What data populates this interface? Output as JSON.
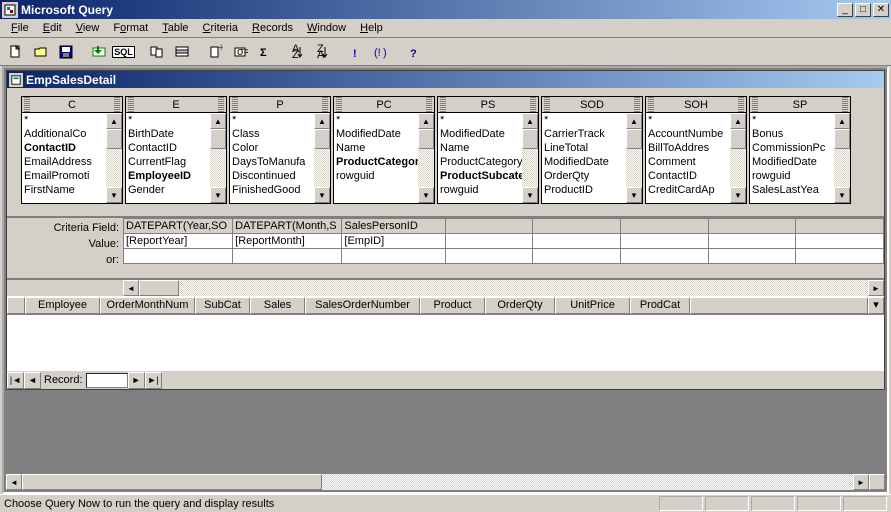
{
  "app": {
    "title": "Microsoft Query"
  },
  "menu": {
    "file": "File",
    "edit": "Edit",
    "view": "View",
    "format": "Format",
    "table": "Table",
    "criteria": "Criteria",
    "records": "Records",
    "window": "Window",
    "help": "Help"
  },
  "child": {
    "title": "EmpSalesDetail"
  },
  "tables": {
    "c": {
      "title": "C",
      "rows": [
        "*",
        "AdditionalCo",
        "ContactID",
        "EmailAddress",
        "EmailPromoti",
        "FirstName"
      ],
      "bold": [
        2
      ]
    },
    "e": {
      "title": "E",
      "rows": [
        "*",
        "BirthDate",
        "ContactID",
        "CurrentFlag",
        "EmployeeID",
        "Gender"
      ],
      "bold": [
        4
      ]
    },
    "p": {
      "title": "P",
      "rows": [
        "*",
        "Class",
        "Color",
        "DaysToManufa",
        "Discontinued",
        "FinishedGood"
      ],
      "bold": []
    },
    "pc": {
      "title": "PC",
      "rows": [
        "*",
        "ModifiedDate",
        "Name",
        "ProductCategory",
        "rowguid"
      ],
      "bold": [
        3
      ]
    },
    "ps": {
      "title": "PS",
      "rows": [
        "*",
        "ModifiedDate",
        "Name",
        "ProductCategory",
        "ProductSubcateg",
        "rowguid"
      ],
      "bold": [
        4
      ]
    },
    "sod": {
      "title": "SOD",
      "rows": [
        "*",
        "CarrierTrack",
        "LineTotal",
        "ModifiedDate",
        "OrderQty",
        "ProductID"
      ],
      "bold": []
    },
    "soh": {
      "title": "SOH",
      "rows": [
        "*",
        "AccountNumbe",
        "BillToAddres",
        "Comment",
        "ContactID",
        "CreditCardAp"
      ],
      "bold": []
    },
    "sp": {
      "title": "SP",
      "rows": [
        "*",
        "Bonus",
        "CommissionPc",
        "ModifiedDate",
        "rowguid",
        "SalesLastYea"
      ],
      "bold": []
    }
  },
  "criteria": {
    "labels": {
      "field": "Criteria Field:",
      "value": "Value:",
      "or": "or:"
    },
    "cols": [
      {
        "field": "DATEPART(Year,SO",
        "value": "[ReportYear]"
      },
      {
        "field": "DATEPART(Month,S",
        "value": "[ReportMonth]"
      },
      {
        "field": "SalesPersonID",
        "value": "[EmpID]"
      }
    ]
  },
  "results": {
    "cols": [
      "Employee",
      "OrderMonthNum",
      "SubCat",
      "Sales",
      "SalesOrderNumber",
      "Product",
      "OrderQty",
      "UnitPrice",
      "ProdCat"
    ]
  },
  "recordnav": {
    "label": "Record:"
  },
  "status": {
    "text": "Choose Query Now to run the query and display results"
  }
}
